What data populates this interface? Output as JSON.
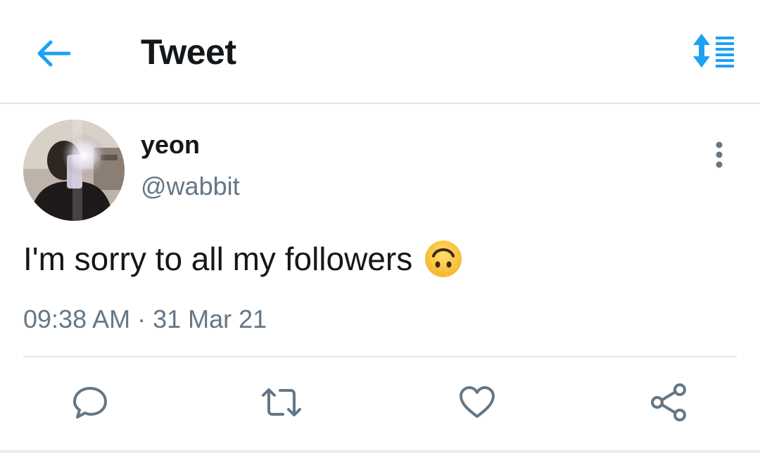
{
  "header": {
    "title": "Tweet",
    "back_icon": "arrow-left-icon",
    "sort_icon": "sort-list-icon",
    "accent_color": "#1da1f2"
  },
  "tweet": {
    "display_name": "yeon",
    "handle": "@wabbit",
    "text": "I'm sorry to all my followers",
    "emoji": "upside-down-face",
    "timestamp": "09:38 AM · 31 Mar 21"
  },
  "actions": [
    {
      "name": "reply",
      "icon": "reply-icon"
    },
    {
      "name": "retweet",
      "icon": "retweet-icon"
    },
    {
      "name": "like",
      "icon": "heart-icon"
    },
    {
      "name": "share",
      "icon": "share-icon"
    }
  ],
  "colors": {
    "text_primary": "#14171a",
    "text_secondary": "#657786",
    "divider": "#e1e5e8",
    "icon_gray": "#657786"
  }
}
